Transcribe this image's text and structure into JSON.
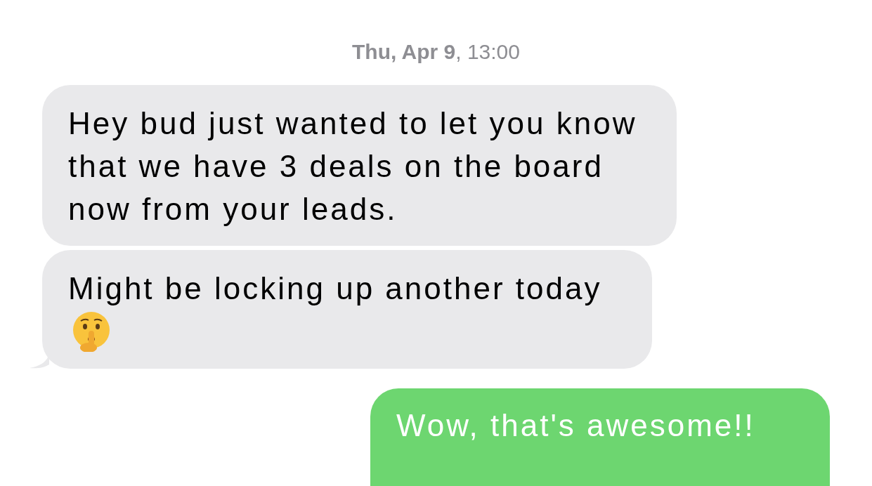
{
  "timestamp": "**Thu, Apr 9**, 13:00",
  "messages": [
    {
      "kind": "received",
      "text": "Hey bud just wanted to let you know that we have 3 deals on the board now from your leads.",
      "tail": false,
      "emoji": false
    },
    {
      "kind": "received",
      "text": "Might be locking up another today",
      "tail": true,
      "emoji": true
    },
    {
      "kind": "sent",
      "text": "Wow, that's awesome!!",
      "tail": false,
      "emoji": false
    }
  ]
}
